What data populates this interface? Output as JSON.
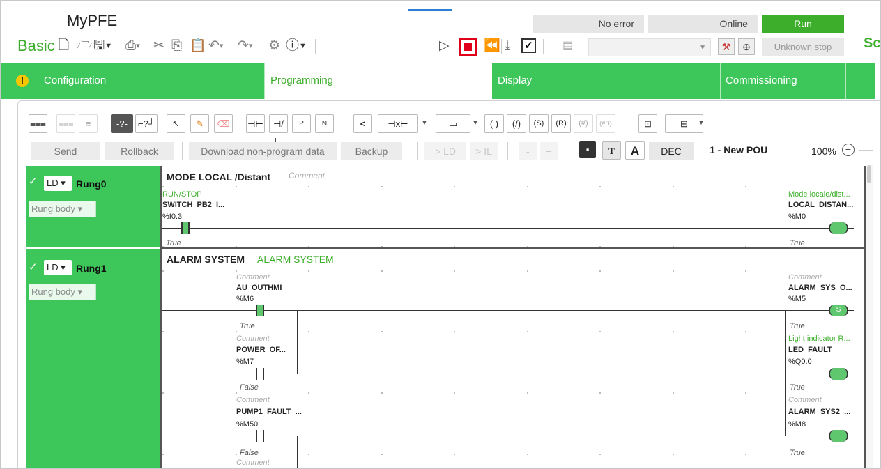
{
  "app": {
    "title": "MyPFE",
    "subtitle": "Basic",
    "brand_partial": "Sc"
  },
  "status": {
    "error": "No error",
    "connection": "Online",
    "run": "Run",
    "unknown_stop": "Unknown stop",
    "run_color": "#3dae2b"
  },
  "toolbar_icons": [
    "new-file-icon",
    "open-folder-icon",
    "save-icon",
    "print-icon",
    "cut-icon",
    "copy-icon",
    "paste-icon",
    "undo-icon",
    "redo-icon",
    "settings-icon",
    "help-icon",
    "play-icon",
    "stop-icon",
    "rewind-icon",
    "download-icon",
    "check-icon",
    "memory-icon"
  ],
  "nav": {
    "tabs": [
      {
        "label": "Configuration"
      },
      {
        "label": "Programming"
      },
      {
        "label": "Display"
      },
      {
        "label": "Commissioning"
      }
    ],
    "accent": "#3dc65a"
  },
  "editor": {
    "toolbar2": {
      "send": "Send",
      "rollback": "Rollback",
      "download": "Download non-program data",
      "backup": "Backup",
      "to_ld": "> LD",
      "to_il": "> IL",
      "minus": "-",
      "plus": "+",
      "dec": "DEC",
      "pou": "1 - New POU",
      "zoom": "100%"
    }
  },
  "rungs": [
    {
      "lang": "LD",
      "name": "Rung0",
      "body": "Rung body",
      "title": "MODE LOCAL /Distant",
      "comment": "Comment",
      "contacts": [
        {
          "comment": "RUN/STOP",
          "symbol": "SWITCH_PB2_I...",
          "address": "%I0.3",
          "state": "True"
        }
      ],
      "coils": [
        {
          "comment": "Mode locale/dist...",
          "symbol": "LOCAL_DISTAN...",
          "address": "%M0",
          "state": "True"
        }
      ]
    },
    {
      "lang": "LD",
      "name": "Rung1",
      "body": "Rung body",
      "title": "ALARM SYSTEM",
      "comment": "ALARM SYSTEM",
      "contacts": [
        {
          "comment": "Comment",
          "symbol": "AU_OUTHMI",
          "address": "%M6",
          "state": "True"
        },
        {
          "comment": "Comment",
          "symbol": "POWER_OF...",
          "address": "%M7",
          "state": "False"
        },
        {
          "comment": "Comment",
          "symbol": "PUMP1_FAULT_...",
          "address": "%M50",
          "state": "False"
        },
        {
          "comment": "Comment"
        }
      ],
      "coils": [
        {
          "comment": "Comment",
          "symbol": "ALARM_SYS_O...",
          "address": "%M5",
          "state": "True",
          "kind": "S"
        },
        {
          "comment": "Light indicator R...",
          "symbol": "LED_FAULT",
          "address": "%Q0.0",
          "state": "True"
        },
        {
          "comment": "Comment",
          "symbol": "ALARM_SYS2_...",
          "address": "%M8",
          "state": "True"
        }
      ]
    }
  ]
}
